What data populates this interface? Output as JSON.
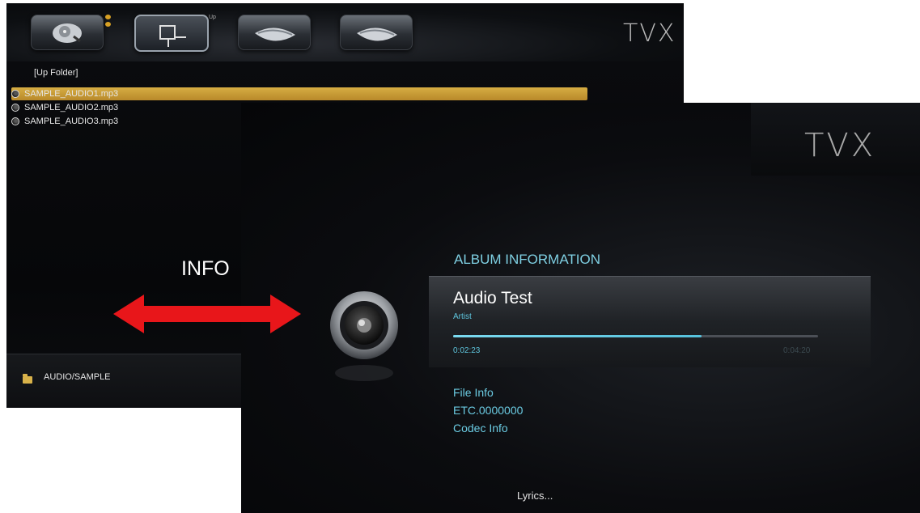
{
  "browser": {
    "logo": "TVX",
    "mini_label": "Up",
    "up_folder": "[Up Folder]",
    "files": [
      {
        "name": "SAMPLE_AUDIO1.mp3",
        "selected": true
      },
      {
        "name": "SAMPLE_AUDIO2.mp3",
        "selected": false
      },
      {
        "name": "SAMPLE_AUDIO3.mp3",
        "selected": false
      }
    ],
    "current_path": "AUDIO/SAMPLE",
    "accent_color": "#d7ad43"
  },
  "transition": {
    "label": "INFO",
    "arrow_color": "#e8161a"
  },
  "album_screen": {
    "logo": "TVX",
    "section_title": "ALBUM INFORMATION",
    "track_title": "Audio Test",
    "artist": "Artist",
    "elapsed": "0:02:23",
    "total": "0:04:20",
    "progress_fraction": 0.68,
    "file_info": [
      "File Info",
      "ETC.0000000",
      "Codec Info"
    ],
    "lyrics_label": "Lyrics...",
    "accent_color": "#5ec5dd"
  }
}
